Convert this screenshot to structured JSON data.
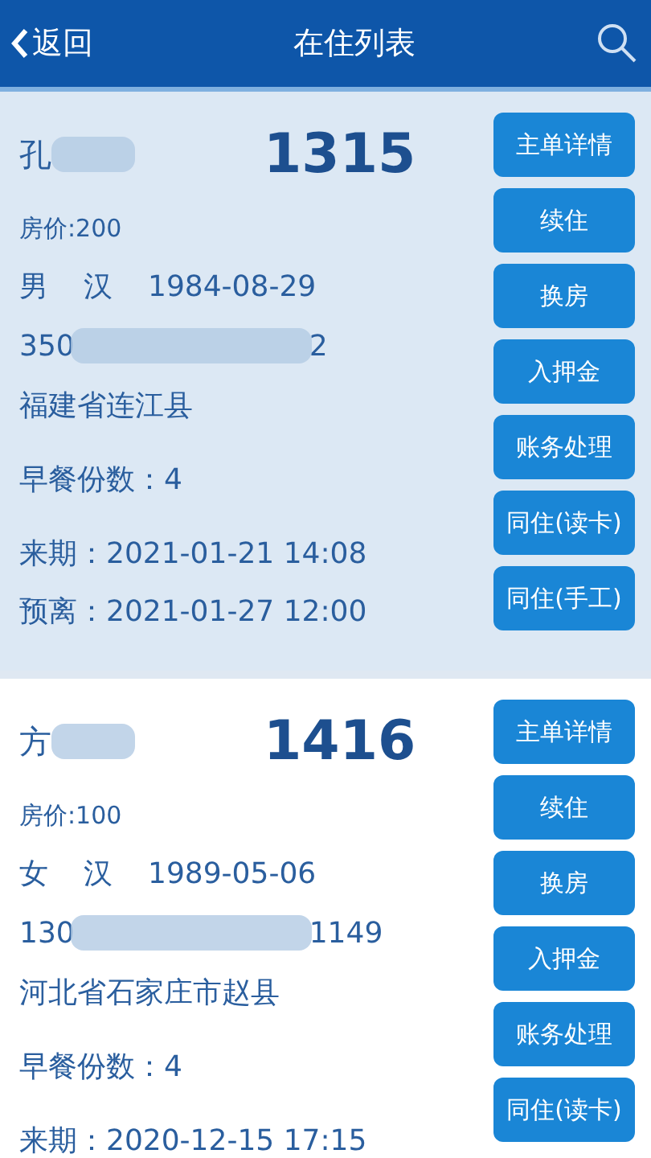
{
  "header": {
    "back": "返回",
    "title": "在住列表"
  },
  "guests": [
    {
      "selected": true,
      "name_visible": "孔",
      "room": "1315",
      "price": "房价:200",
      "gender": "男",
      "ethnicity": "汉",
      "birth": "1984-08-29",
      "id_start": "350",
      "id_end": "2",
      "address": "福建省连江县",
      "breakfast": "早餐份数：4",
      "arrival": "来期：2021-01-21 14:08",
      "departure": "预离：2021-01-27 12:00",
      "buttons": [
        "主单详情",
        "续住",
        "换房",
        "入押金",
        "账务处理",
        "同住(读卡)",
        "同住(手工)"
      ]
    },
    {
      "selected": false,
      "name_visible": "方",
      "room": "1416",
      "price": "房价:100",
      "gender": "女",
      "ethnicity": "汉",
      "birth": "1989-05-06",
      "id_start": "130",
      "id_end": "1149",
      "address": "河北省石家庄市赵县",
      "breakfast": "早餐份数：4",
      "arrival": "来期：2020-12-15 17:15",
      "buttons": [
        "主单详情",
        "续住",
        "换房",
        "入押金",
        "账务处理",
        "同住(读卡)"
      ]
    }
  ]
}
